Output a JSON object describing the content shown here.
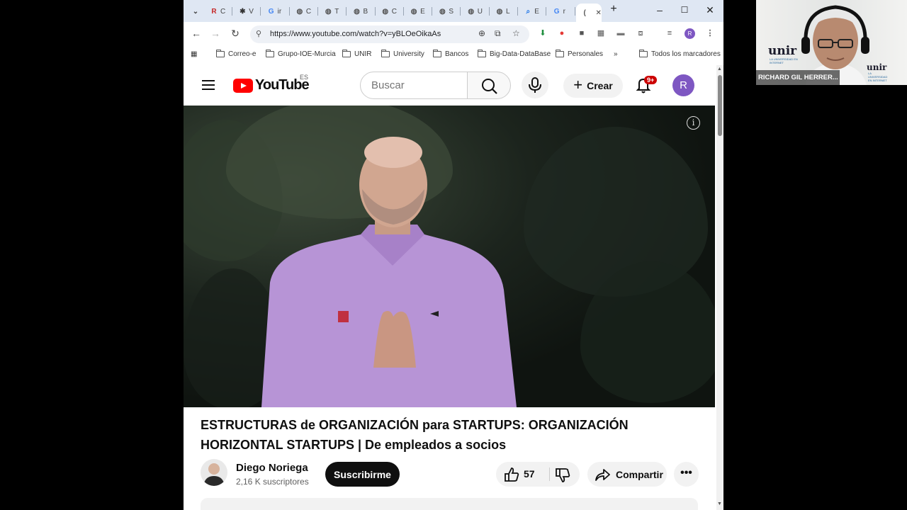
{
  "browser": {
    "tabs": [
      {
        "icon": "zenodo-icon",
        "glyph": "R",
        "letter": "C",
        "color": "#c62828"
      },
      {
        "icon": "joomla-icon",
        "glyph": "✱",
        "letter": "V",
        "color": "#333"
      },
      {
        "icon": "google-icon",
        "glyph": "G",
        "letter": "ir",
        "color": "#4285f4"
      },
      {
        "icon": "globe-icon",
        "glyph": "◍",
        "letter": "C",
        "color": "#555"
      },
      {
        "icon": "globe-icon",
        "glyph": "◍",
        "letter": "T",
        "color": "#555"
      },
      {
        "icon": "globe-icon",
        "glyph": "◍",
        "letter": "B",
        "color": "#555"
      },
      {
        "icon": "globe-icon",
        "glyph": "◍",
        "letter": "C",
        "color": "#555"
      },
      {
        "icon": "globe-icon",
        "glyph": "◍",
        "letter": "E",
        "color": "#555"
      },
      {
        "icon": "globe-icon",
        "glyph": "◍",
        "letter": "S",
        "color": "#555"
      },
      {
        "icon": "globe-icon",
        "glyph": "◍",
        "letter": "U",
        "color": "#555"
      },
      {
        "icon": "globe-icon",
        "glyph": "◍",
        "letter": "L",
        "color": "#555"
      },
      {
        "icon": "search-tab-icon",
        "glyph": "⌕",
        "letter": "E",
        "color": "#1a73e8"
      },
      {
        "icon": "google-icon",
        "glyph": "G",
        "letter": "r",
        "color": "#4285f4"
      },
      {
        "icon": "active-tab-icon",
        "glyph": "(",
        "letter": "",
        "color": "#555"
      }
    ],
    "url": "https://www.youtube.com/watch?v=yBLOeOikaAs",
    "profile_initial": "R",
    "bookmarks": [
      {
        "label": "Correo-e"
      },
      {
        "label": "Grupo-IOE-Murcia"
      },
      {
        "label": "UNIR"
      },
      {
        "label": "University"
      },
      {
        "label": "Bancos"
      },
      {
        "label": "Big-Data-DataBase"
      },
      {
        "label": "Personales"
      }
    ],
    "bookmarks_overflow": "»",
    "all_bookmarks": "Todos los marcadores"
  },
  "youtube": {
    "logo_text": "YouTube",
    "country_code": "ES",
    "search_placeholder": "Buscar",
    "create_label": "Crear",
    "notification_badge": "9+",
    "avatar_initial": "R",
    "video_title": "ESTRUCTURAS de ORGANIZACIÓN para STARTUPS: ORGANIZACIÓN HORIZONTAL STARTUPS | De empleados a socios",
    "channel_name": "Diego Noriega",
    "subscribers": "2,16 K suscriptores",
    "subscribe_label": "Suscribirme",
    "like_count": "57",
    "share_label": "Compartir"
  },
  "webcam": {
    "participant_name": "RICHARD GIL HERRER...",
    "brand": "unir",
    "brand_sub": "LA UNIVERSIDAD EN INTERNET"
  },
  "colors": {
    "youtube_red": "#ff0000",
    "avatar_purple": "#7e57c2",
    "shirt": "#b794d6"
  }
}
